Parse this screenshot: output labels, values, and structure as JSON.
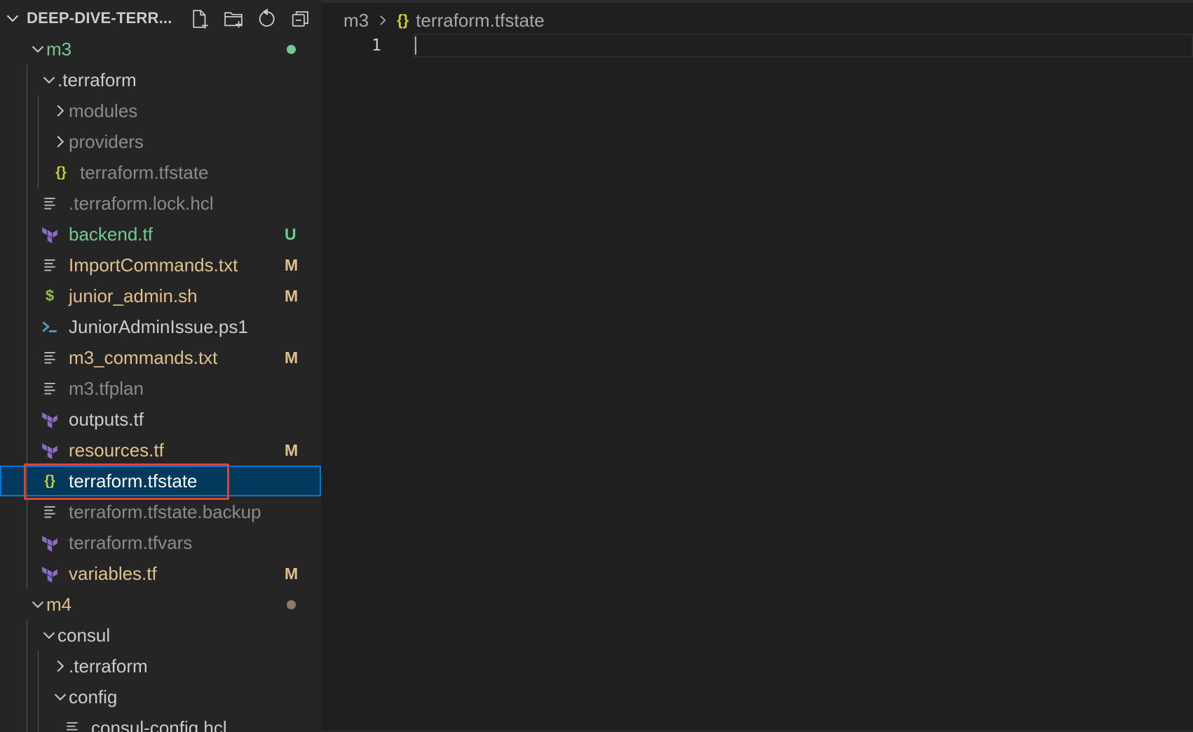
{
  "explorer": {
    "root_title": "DEEP-DIVE-TERR...",
    "actions": [
      {
        "name": "new-file",
        "icon": "new-file-icon"
      },
      {
        "name": "new-folder",
        "icon": "new-folder-icon"
      },
      {
        "name": "refresh",
        "icon": "refresh-icon"
      },
      {
        "name": "collapse-all",
        "icon": "collapse-all-icon"
      }
    ],
    "items": [
      {
        "label": "m3",
        "type": "folder",
        "expanded": true,
        "depth": 0,
        "color": "#73c991",
        "decoration": "dot",
        "dot_color": "#73c991"
      },
      {
        "label": ".terraform",
        "type": "folder",
        "expanded": true,
        "depth": 1,
        "color": "#cccccc"
      },
      {
        "label": "modules",
        "type": "folder",
        "expanded": false,
        "depth": 2,
        "color": "#8b8b8b"
      },
      {
        "label": "providers",
        "type": "folder",
        "expanded": false,
        "depth": 2,
        "color": "#8b8b8b"
      },
      {
        "label": "terraform.tfstate",
        "type": "file",
        "icon": "json-icon",
        "depth": 2,
        "color": "#8b8b8b"
      },
      {
        "label": ".terraform.lock.hcl",
        "type": "file",
        "icon": "text-file-icon",
        "depth": 1,
        "color": "#8b8b8b"
      },
      {
        "label": "backend.tf",
        "type": "file",
        "icon": "terraform-icon",
        "depth": 1,
        "color": "#73c991",
        "badge": "U"
      },
      {
        "label": "ImportCommands.txt",
        "type": "file",
        "icon": "text-file-icon",
        "depth": 1,
        "color": "#e2c08d",
        "badge": "M"
      },
      {
        "label": "junior_admin.sh",
        "type": "file",
        "icon": "shell-icon",
        "depth": 1,
        "color": "#e2c08d",
        "badge": "M"
      },
      {
        "label": "JuniorAdminIssue.ps1",
        "type": "file",
        "icon": "powershell-icon",
        "depth": 1,
        "color": "#cccccc"
      },
      {
        "label": "m3_commands.txt",
        "type": "file",
        "icon": "text-file-icon",
        "depth": 1,
        "color": "#e2c08d",
        "badge": "M"
      },
      {
        "label": "m3.tfplan",
        "type": "file",
        "icon": "text-file-icon",
        "depth": 1,
        "color": "#8b8b8b"
      },
      {
        "label": "outputs.tf",
        "type": "file",
        "icon": "terraform-icon",
        "depth": 1,
        "color": "#cccccc"
      },
      {
        "label": "resources.tf",
        "type": "file",
        "icon": "terraform-icon",
        "depth": 1,
        "color": "#e2c08d",
        "badge": "M"
      },
      {
        "label": "terraform.tfstate",
        "type": "file",
        "icon": "json-icon",
        "depth": 1,
        "color": "#ffffff",
        "selected": true
      },
      {
        "label": "terraform.tfstate.backup",
        "type": "file",
        "icon": "text-file-icon",
        "depth": 1,
        "color": "#8b8b8b"
      },
      {
        "label": "terraform.tfvars",
        "type": "file",
        "icon": "terraform-icon",
        "depth": 1,
        "color": "#8b8b8b"
      },
      {
        "label": "variables.tf",
        "type": "file",
        "icon": "terraform-icon",
        "depth": 1,
        "color": "#e2c08d",
        "badge": "M"
      },
      {
        "label": "m4",
        "type": "folder",
        "expanded": true,
        "depth": 0,
        "color": "#e2c08d",
        "decoration": "dot",
        "dot_color": "#8a7d62"
      },
      {
        "label": "consul",
        "type": "folder",
        "expanded": true,
        "depth": 1,
        "color": "#cccccc"
      },
      {
        "label": ".terraform",
        "type": "folder",
        "expanded": false,
        "depth": 2,
        "color": "#cccccc"
      },
      {
        "label": "config",
        "type": "folder",
        "expanded": true,
        "depth": 2,
        "color": "#cccccc"
      },
      {
        "label": "consul-config.hcl",
        "type": "file",
        "icon": "text-file-icon",
        "depth": 3,
        "color": "#cccccc"
      }
    ]
  },
  "editor": {
    "breadcrumb": {
      "folder": "m3",
      "separator_icon": "chevron-right-icon",
      "file_icon": "{}",
      "file": "terraform.tfstate"
    },
    "line_numbers": [
      "1"
    ]
  },
  "colors": {
    "sidebar_bg": "#252526",
    "editor_bg": "#1f1f1f",
    "selection_bg": "#04395e",
    "selection_border": "#0078d4",
    "highlight_box": "#e0442c",
    "terraform_purple": "#8c6cc4",
    "json_yellow": "#cbcb41",
    "shell_green": "#8dc149",
    "powershell_blue": "#519aba"
  }
}
